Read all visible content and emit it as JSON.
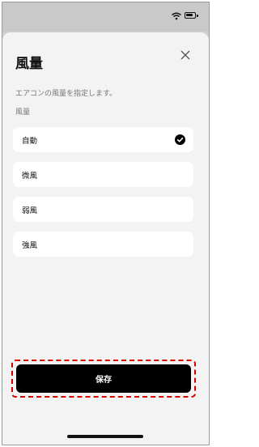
{
  "sheet": {
    "title": "風量",
    "description": "エアコンの風量を指定します。",
    "section_label": "風量"
  },
  "options": [
    {
      "label": "自動",
      "selected": true
    },
    {
      "label": "微風",
      "selected": false
    },
    {
      "label": "弱風",
      "selected": false
    },
    {
      "label": "強風",
      "selected": false
    }
  ],
  "save_button_label": "保存",
  "icons": {
    "close": "close-icon",
    "check": "check-icon",
    "wifi": "wifi-icon",
    "battery": "battery-icon"
  },
  "colors": {
    "accent": "#000000",
    "highlight_border": "#d40000",
    "sheet_background": "#f3f3f3"
  }
}
